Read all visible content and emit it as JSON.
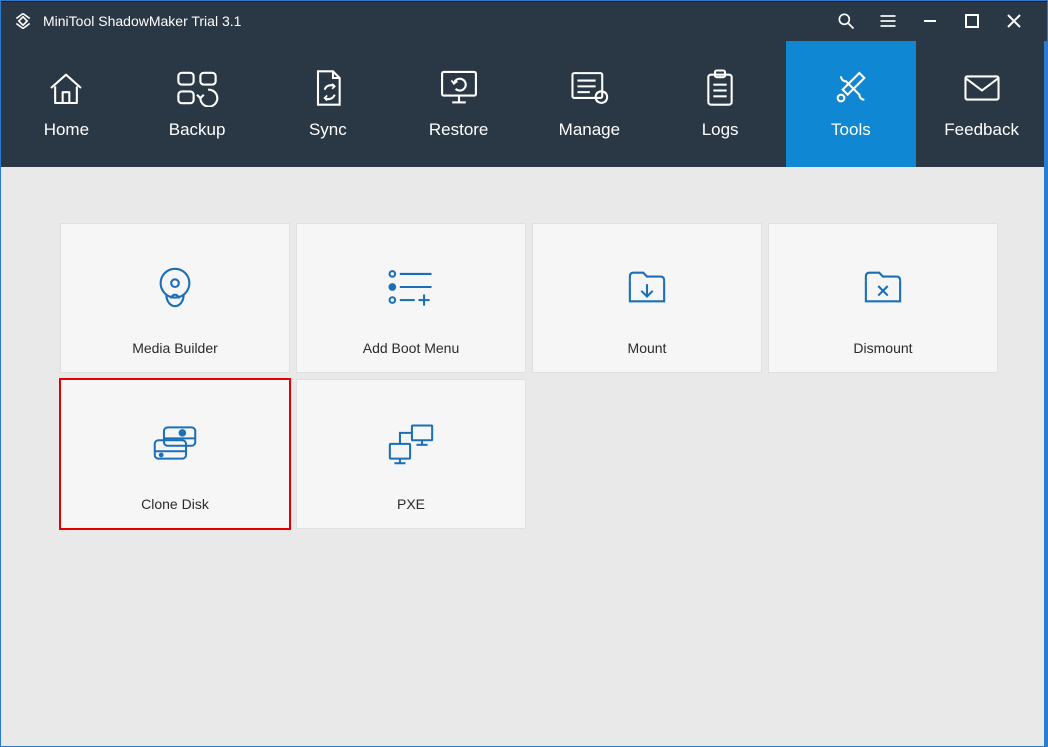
{
  "titlebar": {
    "title": "MiniTool ShadowMaker Trial 3.1"
  },
  "nav": {
    "items": [
      {
        "label": "Home"
      },
      {
        "label": "Backup"
      },
      {
        "label": "Sync"
      },
      {
        "label": "Restore"
      },
      {
        "label": "Manage"
      },
      {
        "label": "Logs"
      },
      {
        "label": "Tools"
      },
      {
        "label": "Feedback"
      }
    ],
    "active_index": 6
  },
  "tools": {
    "tiles": [
      {
        "label": "Media Builder"
      },
      {
        "label": "Add Boot Menu"
      },
      {
        "label": "Mount"
      },
      {
        "label": "Dismount"
      },
      {
        "label": "Clone Disk"
      },
      {
        "label": "PXE"
      }
    ],
    "highlight_index": 4
  },
  "colors": {
    "accent": "#0f87d2",
    "header": "#2a3744",
    "icon": "#1976d2"
  }
}
